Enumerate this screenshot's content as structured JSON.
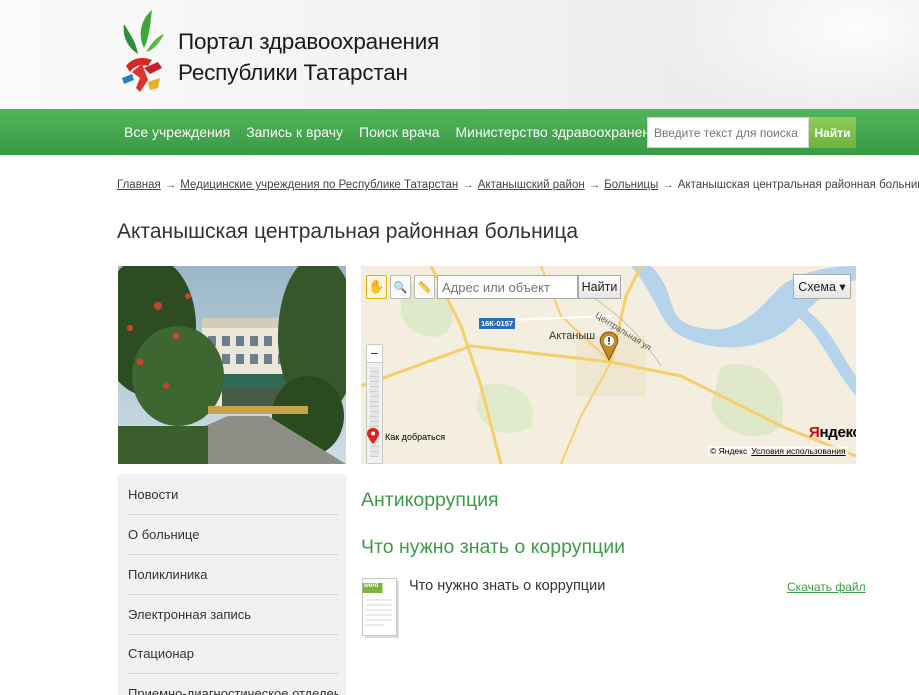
{
  "header": {
    "title_line1": "Портал здравоохранения",
    "title_line2": "Республики Татарстан"
  },
  "nav": {
    "items": [
      {
        "label": "Все учреждения"
      },
      {
        "label": "Запись к врачу"
      },
      {
        "label": "Поиск врача"
      },
      {
        "label": "Министерство здравоохранения РТ"
      }
    ],
    "search_placeholder": "Введите текст для поиска",
    "search_button": "Найти"
  },
  "breadcrumb": {
    "items": [
      {
        "label": "Главная"
      },
      {
        "label": "Медицинские учреждения по Республике Татарстан"
      },
      {
        "label": "Актанышский район"
      },
      {
        "label": "Больницы"
      }
    ],
    "current": "Актанышская центральная районная больница",
    "separator": "→"
  },
  "page": {
    "title": "Актанышская центральная районная больница"
  },
  "map": {
    "search_placeholder": "Адрес или объект",
    "find_button": "Найти",
    "scheme_label": "Схема ▾",
    "zoom_minus": "−",
    "route_label": "Как добраться",
    "logo_red": "Я",
    "logo_black": "ндекс",
    "copyright": "© Яндекс",
    "terms_link": "Условия использования",
    "town_label": "Актаныш",
    "road_tag": "16К-0157",
    "street_label": "Центральная ул"
  },
  "sidebar": {
    "items": [
      {
        "label": "Новости"
      },
      {
        "label": "О больнице"
      },
      {
        "label": "Поликлиника"
      },
      {
        "label": "Электронная запись"
      },
      {
        "label": "Стационар"
      },
      {
        "label": "Приемно-диагностическое отделение"
      }
    ]
  },
  "content": {
    "section_title": "Антикоррупция",
    "subsection_title": "Что нужно знать о коррупции",
    "document": {
      "icon_label": "word",
      "title": "Что нужно знать о коррупции",
      "download_label": "Скачать файл"
    }
  },
  "colors": {
    "nav_green": "#3a9a45",
    "heading_green": "#3d9b47",
    "search_button_green": "#6fb43a"
  }
}
